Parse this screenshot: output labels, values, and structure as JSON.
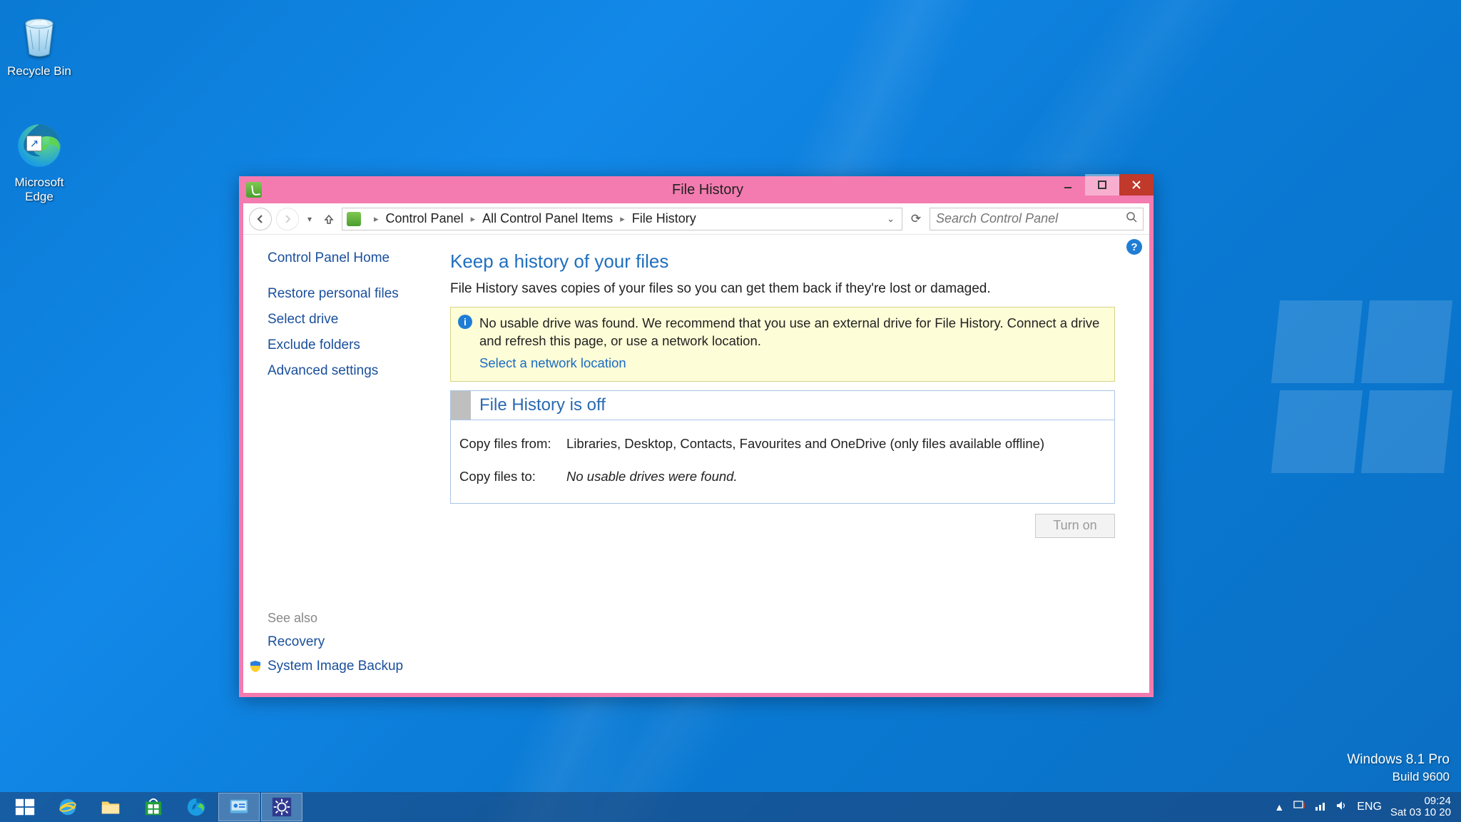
{
  "desktop": {
    "recycle_bin": "Recycle Bin",
    "edge": "Microsoft Edge"
  },
  "watermark": {
    "line1": "Windows 8.1 Pro",
    "line2": "Build 9600"
  },
  "window": {
    "title": "File History",
    "breadcrumb": {
      "p1": "Control Panel",
      "p2": "All Control Panel Items",
      "p3": "File History"
    },
    "search_placeholder": "Search Control Panel",
    "help_tooltip": "?"
  },
  "sidebar": {
    "home": "Control Panel Home",
    "links": {
      "restore": "Restore personal files",
      "select_drive": "Select drive",
      "exclude": "Exclude folders",
      "advanced": "Advanced settings"
    },
    "see_also": "See also",
    "recovery": "Recovery",
    "sysimg": "System Image Backup"
  },
  "main": {
    "heading": "Keep a history of your files",
    "subhead": "File History saves copies of your files so you can get them back if they're lost or damaged.",
    "info_text": "No usable drive was found. We recommend that you use an external drive for File History. Connect a drive and refresh this page, or use a network location.",
    "info_link": "Select a network location",
    "status_title": "File History is off",
    "copy_from_label": "Copy files from:",
    "copy_from_value": "Libraries, Desktop, Contacts, Favourites and OneDrive (only files available offline)",
    "copy_to_label": "Copy files to:",
    "copy_to_value": "No usable drives were found.",
    "turn_on": "Turn on"
  },
  "tray": {
    "lang": "ENG",
    "time": "09:24",
    "date": "Sat 03 10 20"
  }
}
